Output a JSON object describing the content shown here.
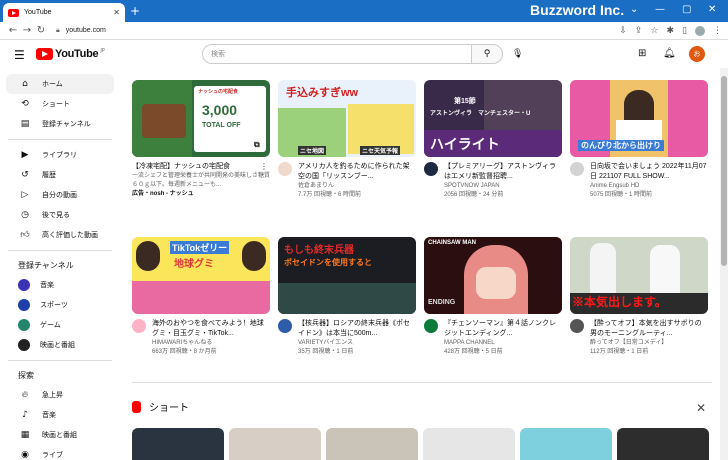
{
  "browser": {
    "tab_title": "YouTube",
    "url": "youtube.com",
    "brand": "Buzzword Inc."
  },
  "header": {
    "logo_text": "YouTube",
    "logo_region": "JP",
    "search_placeholder": "検索",
    "avatar_letter": "お"
  },
  "sidebar": {
    "main": [
      {
        "label": "ホーム",
        "icon": "home-icon"
      },
      {
        "label": "ショート",
        "icon": "shorts-icon"
      },
      {
        "label": "登録チャンネル",
        "icon": "subscriptions-icon"
      }
    ],
    "library": [
      {
        "label": "ライブラリ",
        "icon": "library-icon"
      },
      {
        "label": "履歴",
        "icon": "history-icon"
      },
      {
        "label": "自分の動画",
        "icon": "my-videos-icon"
      },
      {
        "label": "後で見る",
        "icon": "watch-later-icon"
      },
      {
        "label": "高く評価した動画",
        "icon": "liked-icon"
      }
    ],
    "subscriptions_heading": "登録チャンネル",
    "subscriptions": [
      {
        "label": "音楽",
        "color": "#3a34b5"
      },
      {
        "label": "スポーツ",
        "color": "#1f3fa8"
      },
      {
        "label": "ゲーム",
        "color": "#23856b"
      },
      {
        "label": "映画と番組",
        "color": "#222222"
      }
    ],
    "explore_heading": "探索",
    "explore": [
      {
        "label": "急上昇",
        "icon": "trending-icon"
      },
      {
        "label": "音楽",
        "icon": "music-icon"
      },
      {
        "label": "映画と番組",
        "icon": "movies-icon"
      },
      {
        "label": "ライブ",
        "icon": "live-icon"
      }
    ]
  },
  "videos": [
    {
      "title": "【冷凍宅配】ナッシュの宅配食",
      "desc": "一流シェフと管理栄養士が共同開発の美味しさ糖質６０ｇ以下。毎週新メニューも...",
      "channel": "広告・nosh - ナッシュ",
      "stats": "",
      "thumb_text": "3,000",
      "thumb_sub": "TOTAL OFF",
      "thumb_top": "ナッシュの宅配食"
    },
    {
      "title": "アメリカ人を釣るために作られた架空の国「リッスンブー...",
      "desc": "",
      "channel": "佐倉あまりん",
      "stats": "7.7万 回視聴・6 時間前",
      "thumb_text": "手込みすぎww",
      "thumb_sub": "ニセ地図",
      "thumb_top": "ニセ天気予報"
    },
    {
      "title": "【プレミアリーグ】アストンヴィラはエメリ新監督招聘...",
      "desc": "",
      "channel": "SPOTVNOW JAPAN",
      "stats": "2056 回視聴・24 分前",
      "thumb_text": "ハイライト",
      "thumb_sub": "第15節",
      "thumb_top": "アストンヴィラ　マンチェスター・U"
    },
    {
      "title": "日向坂で会いましょう 2022年11月07日 221107 FULL SHOW...",
      "desc": "",
      "channel": "Anime Engsub HD",
      "stats": "5075 回視聴・1 時間前",
      "thumb_text": "のんびり北から出けり",
      "thumb_sub": "",
      "thumb_top": ""
    },
    {
      "title": "海外のおやつを食べてみよう！地球グミ・目玉グミ・TikTok...",
      "desc": "",
      "channel": "HIMAWARIちゃんねる",
      "stats": "663万 回視聴・8 か月前",
      "thumb_text": "TikTokゼリー",
      "thumb_sub": "地球グミ",
      "thumb_top": ""
    },
    {
      "title": "【核兵器】ロシアの終末兵器《ポセイドン》は本当に500m...",
      "desc": "",
      "channel": "VARIETYバイエンス",
      "stats": "35万 回視聴・1 日前",
      "thumb_text": "もしも終末兵器",
      "thumb_sub": "ポセイドンを使用すると",
      "thumb_top": ""
    },
    {
      "title": "『チェンソーマン』第４話ノンクレジットエンディング...",
      "desc": "",
      "channel": "MAPPA CHANNEL",
      "stats": "428万 回視聴・5 日前",
      "thumb_text": "CHAINSAW MAN",
      "thumb_sub": "ENDING",
      "thumb_top": ""
    },
    {
      "title": "【酔ってオフ】本気を出すサボりの男のモーニングルーティ...",
      "desc": "",
      "channel": "酔ってオフ【日常コメディ】",
      "stats": "112万 回視聴・1 日前",
      "thumb_text": "※本気出します。",
      "thumb_sub": "",
      "thumb_top": ""
    }
  ],
  "shorts": {
    "heading": "ショート"
  }
}
